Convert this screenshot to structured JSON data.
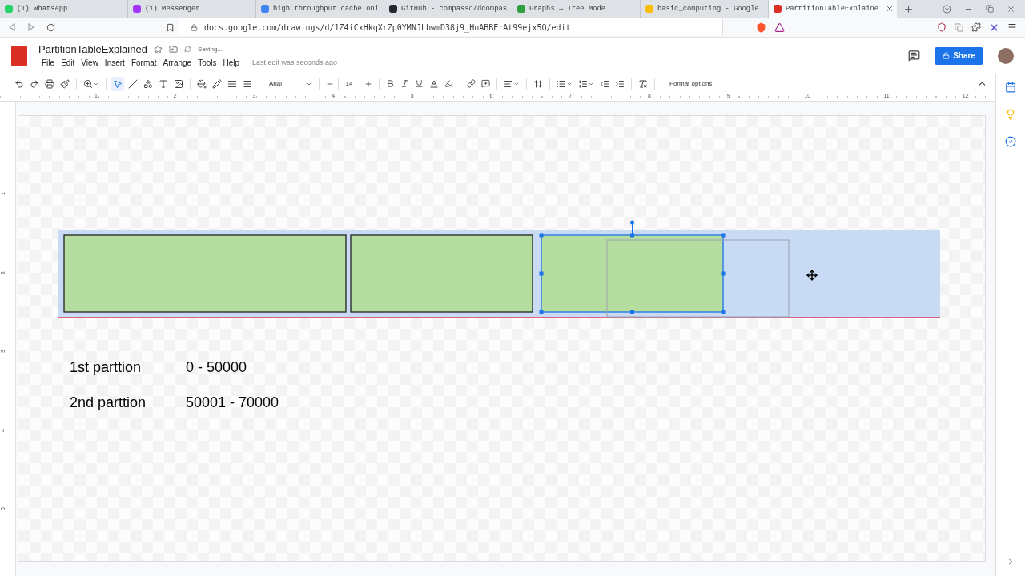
{
  "browser": {
    "tabs": [
      {
        "title": "(1) WhatsApp",
        "color": "#25d366",
        "selected": false
      },
      {
        "title": "(1) Messenger",
        "color": "#a334fa",
        "selected": false
      },
      {
        "title": "high throughput cache onl",
        "color": "#4285f4",
        "selected": false
      },
      {
        "title": "GitHub - compassd/dcompas",
        "color": "#24292f",
        "selected": false
      },
      {
        "title": "Graphs → Tree Mode",
        "color": "#2e9e3e",
        "selected": false
      },
      {
        "title": "basic_computing - Google",
        "color": "#fbbc04",
        "selected": false
      },
      {
        "title": "PartitionTableExplaine",
        "color": "#d93025",
        "selected": true
      }
    ],
    "url": "docs.google.com/drawings/d/1Z4iCxHkqXrZp0YMNJLbwmD38j9_HnABBErAt99ejx5Q/edit"
  },
  "document": {
    "title": "PartitionTableExplained",
    "status": "Saving...",
    "menu": [
      "File",
      "Edit",
      "View",
      "Insert",
      "Format",
      "Arrange",
      "Tools",
      "Help"
    ],
    "last_edit": "Last edit was seconds ago",
    "share": "Share"
  },
  "toolbar": {
    "tools": [
      {
        "kind": "select",
        "selected": true
      },
      {
        "kind": "line",
        "selected": false
      },
      {
        "kind": "shape",
        "selected": false
      },
      {
        "kind": "textbox",
        "selected": false
      },
      {
        "kind": "image",
        "selected": false
      }
    ],
    "font": "Arial",
    "font_size": "14",
    "format_options": "Format options"
  },
  "rulers": {
    "horizontal": [
      "1",
      "2",
      "3",
      "4",
      "5",
      "6",
      "7",
      "8",
      "9",
      "10",
      "11",
      "12"
    ],
    "vertical": [
      "1",
      "2",
      "3",
      "4",
      "5"
    ]
  },
  "canvas": {
    "boxes": [
      {
        "selected": false
      },
      {
        "selected": false
      },
      {
        "selected": true
      }
    ],
    "rows": [
      {
        "label": "1st parttion",
        "range": "0 - 50000"
      },
      {
        "label": "2nd parttion",
        "range": "50001 - 70000"
      }
    ]
  }
}
